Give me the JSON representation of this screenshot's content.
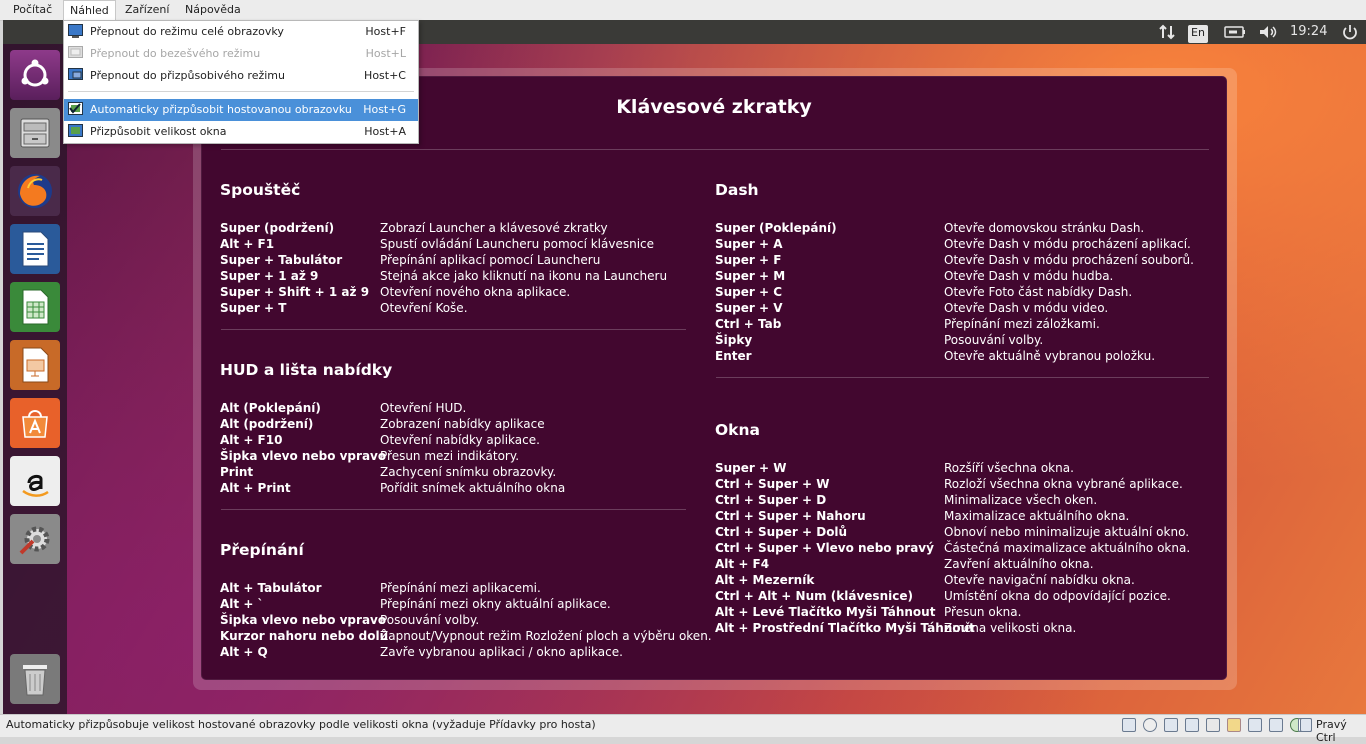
{
  "host_menubar": {
    "items": [
      "Počítač",
      "Náhled",
      "Zařízení",
      "Nápověda"
    ]
  },
  "view_menu": {
    "items": [
      {
        "label": "Přepnout do režimu celé obrazovky",
        "shortcut": "Host+F",
        "enabled": true
      },
      {
        "label": "Přepnout do bezešvého režimu",
        "shortcut": "Host+L",
        "enabled": false
      },
      {
        "label": "Přepnout do přizpůsobivého režimu",
        "shortcut": "Host+C",
        "enabled": true
      },
      {
        "label": "Automaticky přizpůsobit hostovanou obrazovku",
        "shortcut": "Host+G",
        "enabled": true,
        "highlighted": true,
        "checked": true
      },
      {
        "label": "Přizpůsobit velikost okna",
        "shortcut": "Host+A",
        "enabled": true
      }
    ]
  },
  "top_panel": {
    "keyboard_layout": "En",
    "clock": "19:24",
    "icons": [
      "network-transfer-icon",
      "battery-icon",
      "volume-icon",
      "power-icon"
    ]
  },
  "launcher": {
    "apps": [
      "ubuntu-dash-icon",
      "files-icon",
      "firefox-icon",
      "libreoffice-writer-icon",
      "libreoffice-calc-icon",
      "libreoffice-impress-icon",
      "software-center-icon",
      "amazon-icon",
      "system-settings-icon"
    ],
    "trash": "trash-icon"
  },
  "shortcuts": {
    "title": "Klávesové zkratky",
    "launcher": {
      "title": "Spouštěč",
      "rows": [
        {
          "key": "Super (podržení)",
          "desc": "Zobrazí Launcher a klávesové zkratky"
        },
        {
          "key": "Alt + F1",
          "desc": "Spustí ovládání Launcheru pomocí klávesnice"
        },
        {
          "key": "Super + Tabulátor",
          "desc": "Přepínání aplikací pomocí Launcheru"
        },
        {
          "key": "Super + 1 až 9",
          "desc": "Stejná akce jako kliknutí na ikonu na Launcheru"
        },
        {
          "key": "Super + Shift + 1 až 9",
          "desc": "Otevření nového okna aplikace."
        },
        {
          "key": "Super + T",
          "desc": "Otevření Koše."
        }
      ]
    },
    "hud": {
      "title": "HUD a lišta nabídky",
      "rows": [
        {
          "key": "Alt (Poklepání)",
          "desc": "Otevření HUD."
        },
        {
          "key": "Alt (podržení)",
          "desc": "Zobrazení nabídky aplikace"
        },
        {
          "key": "Alt + F10",
          "desc": "Otevření nabídky aplikace."
        },
        {
          "key": "Šipka vlevo nebo vpravo",
          "desc": "Přesun mezi indikátory."
        },
        {
          "key": "Print",
          "desc": "Zachycení snímku obrazovky."
        },
        {
          "key": "Alt + Print",
          "desc": "Pořídit snímek aktuálního okna"
        }
      ]
    },
    "switching": {
      "title": "Přepínání",
      "rows": [
        {
          "key": "Alt + Tabulátor",
          "desc": "Přepínání mezi aplikacemi."
        },
        {
          "key": "Alt + `",
          "desc": "Přepínání mezi okny aktuální aplikace."
        },
        {
          "key": "Šipka vlevo nebo vpravo",
          "desc": "Posouvání volby."
        },
        {
          "key": "Kurzor nahoru nebo dolů",
          "desc": "Zapnout/Vypnout režim Rozložení ploch a výběru oken."
        },
        {
          "key": "Alt + Q",
          "desc": "Zavře vybranou aplikaci / okno aplikace."
        }
      ]
    },
    "dash": {
      "title": "Dash",
      "rows": [
        {
          "key": "Super (Poklepání)",
          "desc": "Otevře domovskou stránku Dash."
        },
        {
          "key": "Super + A",
          "desc": "Otevře Dash v módu procházení aplikací."
        },
        {
          "key": "Super + F",
          "desc": "Otevře Dash v módu procházení souborů."
        },
        {
          "key": "Super + M",
          "desc": "Otevře Dash v módu hudba."
        },
        {
          "key": "Super + C",
          "desc": "Otevře Foto část nabídky Dash."
        },
        {
          "key": "Super + V",
          "desc": "Otevře Dash v módu video."
        },
        {
          "key": "Ctrl + Tab",
          "desc": "Přepínání mezi záložkami."
        },
        {
          "key": "Šipky",
          "desc": "Posouvání volby."
        },
        {
          "key": "Enter",
          "desc": "Otevře aktuálně vybranou položku."
        }
      ]
    },
    "windows": {
      "title": "Okna",
      "rows": [
        {
          "key": "Super + W",
          "desc": "Rozšíří všechna okna."
        },
        {
          "key": "Ctrl + Super + W",
          "desc": "Rozloží všechna okna vybrané aplikace."
        },
        {
          "key": "Ctrl + Super + D",
          "desc": "Minimalizace všech oken."
        },
        {
          "key": "Ctrl + Super + Nahoru",
          "desc": "Maximalizace aktuálního okna."
        },
        {
          "key": "Ctrl + Super + Dolů",
          "desc": "Obnoví nebo minimalizuje aktuální okno."
        },
        {
          "key": "Ctrl + Super + Vlevo nebo pravý",
          "desc": "Částečná maximalizace aktuálního okna."
        },
        {
          "key": "Alt + F4",
          "desc": "Zavření aktuálního okna."
        },
        {
          "key": "Alt + Mezerník",
          "desc": "Otevře navigační nabídku okna."
        },
        {
          "key": "Ctrl + Alt + Num (klávesnice)",
          "desc": "Umístění okna do odpovídající pozice."
        },
        {
          "key": "Alt + Levé Tlačítko Myši Táhnout",
          "desc": "Přesun okna."
        },
        {
          "key": "Alt + Prostřední Tlačítko Myši Táhnout",
          "desc": "Změna velikosti okna."
        }
      ]
    }
  },
  "statusbar": {
    "message": "Automaticky přizpůsobuje velikost hostované obrazovky podle velikosti okna (vyžaduje Přídavky pro hosta)",
    "host_key": "Pravý Ctrl",
    "icons": [
      "hard-disk-icon",
      "optical-drive-icon",
      "audio-icon",
      "network-icon",
      "usb-icon",
      "shared-folders-icon",
      "display-icon",
      "video-capture-icon",
      "virtualization-icon",
      "mouse-integration-icon",
      "keyboard-capture-icon"
    ]
  }
}
